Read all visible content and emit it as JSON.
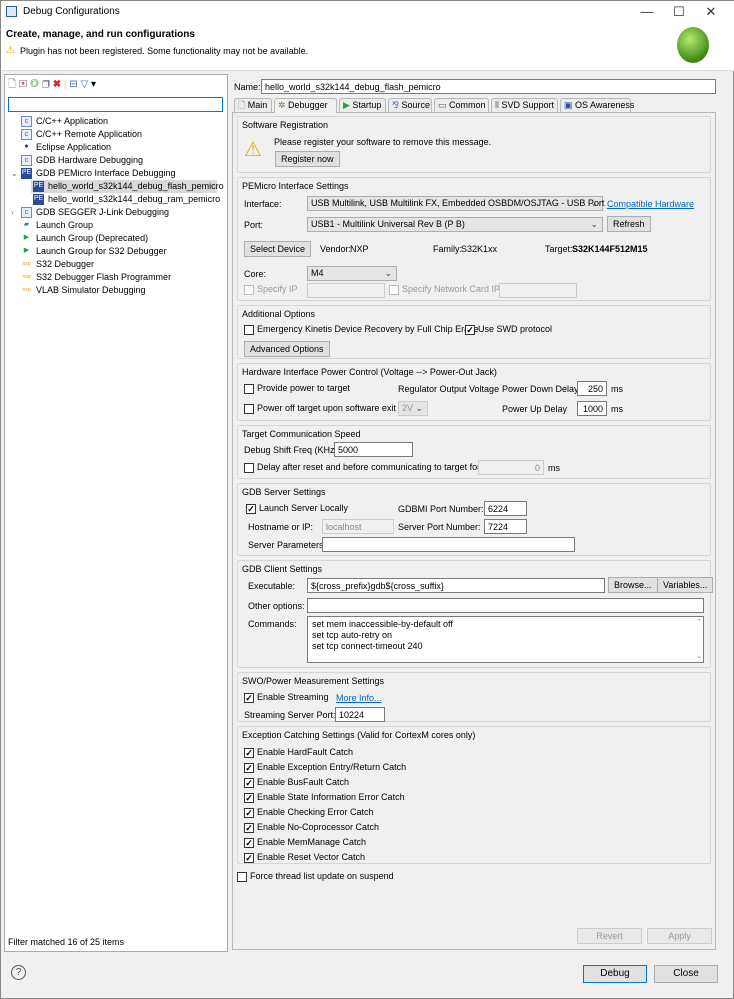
{
  "window": {
    "title": "Debug Configurations",
    "minimize": "—",
    "maximize": "☐",
    "close": "✕"
  },
  "header": {
    "title": "Create, manage, and run configurations",
    "warning": "Plugin has not been registered. Some functionality may not be available."
  },
  "left": {
    "filter_placeholder": "",
    "tree": [
      {
        "label": "C/C++ Application",
        "icon": "c-app-icon",
        "level": 0
      },
      {
        "label": "C/C++ Remote Application",
        "icon": "c-app-icon",
        "level": 0
      },
      {
        "label": "Eclipse Application",
        "icon": "eclipse-icon",
        "level": 0
      },
      {
        "label": "GDB Hardware Debugging",
        "icon": "c-app-icon",
        "level": 0
      },
      {
        "label": "GDB PEMicro Interface Debugging",
        "icon": "pe-icon",
        "level": 0,
        "expanded": true
      },
      {
        "label": "hello_world_s32k144_debug_flash_pemicro",
        "icon": "pe-icon",
        "level": 1,
        "selected": true
      },
      {
        "label": "hello_world_s32k144_debug_ram_pemicro",
        "icon": "pe-icon",
        "level": 1
      },
      {
        "label": "GDB SEGGER J-Link Debugging",
        "icon": "c-app-icon",
        "level": 0,
        "collapsed": true
      },
      {
        "label": "Launch Group",
        "icon": "launch-group-icon",
        "level": 0
      },
      {
        "label": "Launch Group (Deprecated)",
        "icon": "play-icon",
        "level": 0
      },
      {
        "label": "Launch Group for S32 Debugger",
        "icon": "play-icon",
        "level": 0
      },
      {
        "label": "S32 Debugger",
        "icon": "nxp-icon",
        "level": 0
      },
      {
        "label": "S32 Debugger Flash Programmer",
        "icon": "nxp-icon",
        "level": 0
      },
      {
        "label": "VLAB Simulator Debugging",
        "icon": "nxp-icon",
        "level": 0
      }
    ],
    "status": "Filter matched 16 of 25 items"
  },
  "name": {
    "label": "Name:",
    "value": "hello_world_s32k144_debug_flash_pemicro"
  },
  "tabs": [
    "Main",
    "Debugger",
    "Startup",
    "Source",
    "Common",
    "SVD Support",
    "OS Awareness"
  ],
  "reg": {
    "title": "Software Registration",
    "message": "Please register your software to remove this message.",
    "button": "Register now"
  },
  "pe": {
    "title": "PEMicro Interface Settings",
    "interface_label": "Interface:",
    "interface_value": "USB Multilink, USB Multilink FX, Embedded OSBDM/OSJTAG - USB Port",
    "compat_link": "Compatible Hardware",
    "port_label": "Port:",
    "port_value": "USB1 - Multilink Universal Rev B (P         B)",
    "refresh": "Refresh",
    "select_device": "Select Device",
    "vendor_label": "Vendor:",
    "vendor": "NXP",
    "family_label": "Family:",
    "family": "S32K1xx",
    "target_label": "Target:",
    "target": "S32K144F512M15",
    "core_label": "Core:",
    "core": "M4",
    "specify_ip": "Specify IP",
    "specify_nic": "Specify Network Card IP"
  },
  "opts": {
    "title": "Additional Options",
    "emergency": "Emergency Kinetis Device Recovery by Full Chip Erase",
    "swd": "Use SWD protocol",
    "advanced": "Advanced Options"
  },
  "power": {
    "title": "Hardware Interface Power Control (Voltage --> Power-Out Jack)",
    "provide": "Provide power to target",
    "regulator": "Regulator Output Voltage",
    "power_down": "Power Down Delay",
    "power_down_value": "250",
    "ms1": "ms",
    "power_off": "Power off target upon software exit",
    "voltage": "2V",
    "power_up": "Power Up Delay",
    "power_up_value": "1000",
    "ms2": "ms"
  },
  "speed": {
    "title": "Target Communication Speed",
    "freq_label": "Debug Shift Freq (KHz)",
    "freq": "5000",
    "delay": "Delay after reset and before communicating to target for",
    "delay_value": "0",
    "ms": "ms"
  },
  "gdbserver": {
    "title": "GDB Server Settings",
    "launch": "Launch Server Locally",
    "gdbmi_label": "GDBMI Port Number:",
    "gdbmi": "6224",
    "host_label": "Hostname or IP:",
    "host": "localhost",
    "port_label": "Server Port Number:",
    "port": "7224",
    "params_label": "Server Parameters:",
    "params": ""
  },
  "gdbclient": {
    "title": "GDB Client Settings",
    "exe_label": "Executable:",
    "exe": "${cross_prefix}gdb${cross_suffix}",
    "browse": "Browse...",
    "variables": "Variables...",
    "other_label": "Other options:",
    "other": "",
    "commands_label": "Commands:",
    "commands": [
      "set mem inaccessible-by-default off",
      "set tcp auto-retry on",
      "set tcp connect-timeout 240"
    ]
  },
  "swo": {
    "title": "SWO/Power Measurement Settings",
    "enable": "Enable Streaming",
    "more": "More Info...",
    "port_label": "Streaming Server Port:",
    "port": "10224"
  },
  "exc": {
    "title": "Exception Catching Settings (Valid for CortexM cores only)",
    "items": [
      "Enable HardFault Catch",
      "Enable Exception Entry/Return Catch",
      "Enable BusFault Catch",
      "Enable State Information Error Catch",
      "Enable Checking Error Catch",
      "Enable No-Coprocessor Catch",
      "Enable MemManage Catch",
      "Enable Reset Vector Catch"
    ]
  },
  "force": "Force thread list update on suspend",
  "actions": {
    "revert": "Revert",
    "apply": "Apply",
    "debug": "Debug",
    "close": "Close",
    "help": "?"
  }
}
